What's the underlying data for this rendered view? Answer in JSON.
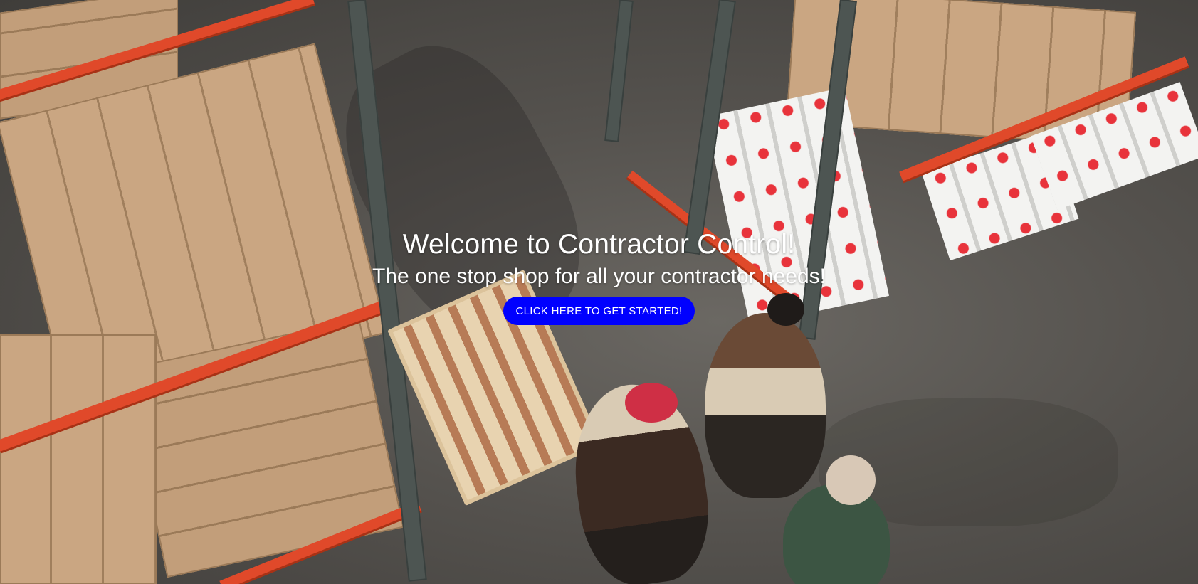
{
  "hero": {
    "title": "Welcome to Contractor Control!",
    "subtitle": "The one stop shop for all your contractor needs!",
    "cta_label": "CLICK HERE TO GET STARTED!",
    "background_image": "warehouse-photo"
  },
  "colors": {
    "cta_background": "#0000ff",
    "text": "#ffffff"
  }
}
